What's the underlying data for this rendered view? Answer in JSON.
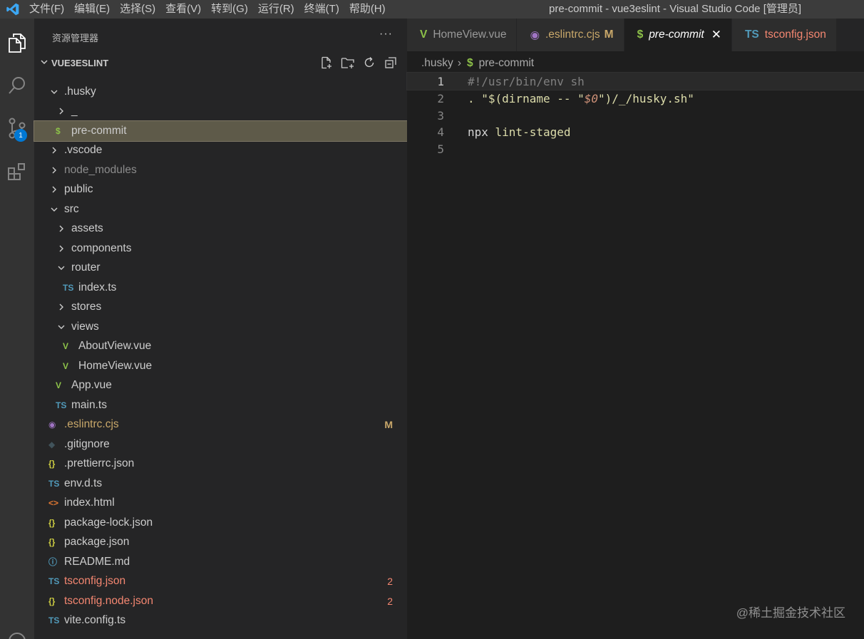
{
  "titlebar": {
    "menu": [
      "文件(F)",
      "编辑(E)",
      "选择(S)",
      "查看(V)",
      "转到(G)",
      "运行(R)",
      "终端(T)",
      "帮助(H)"
    ],
    "title": "pre-commit - vue3eslint - Visual Studio Code [管理员]"
  },
  "activitybar": {
    "icons": [
      "explorer-icon",
      "search-icon",
      "source-control-icon",
      "extensions-icon",
      "account-icon"
    ],
    "scm_badge": "1"
  },
  "sidebar": {
    "header": "资源管理器",
    "more": "···",
    "section": "VUE3ESLINT",
    "tree": [
      {
        "label": ".husky",
        "depth": 0,
        "kind": "folder-open"
      },
      {
        "label": "_",
        "depth": 1,
        "kind": "folder"
      },
      {
        "label": "pre-commit",
        "depth": 1,
        "kind": "file",
        "icon": "$",
        "iconColor": "#8dc149",
        "selected": true
      },
      {
        "label": ".vscode",
        "depth": 0,
        "kind": "folder"
      },
      {
        "label": "node_modules",
        "depth": 0,
        "kind": "folder",
        "dim": true
      },
      {
        "label": "public",
        "depth": 0,
        "kind": "folder"
      },
      {
        "label": "src",
        "depth": 0,
        "kind": "folder-open"
      },
      {
        "label": "assets",
        "depth": 1,
        "kind": "folder"
      },
      {
        "label": "components",
        "depth": 1,
        "kind": "folder"
      },
      {
        "label": "router",
        "depth": 1,
        "kind": "folder-open"
      },
      {
        "label": "index.ts",
        "depth": 2,
        "kind": "file",
        "icon": "TS",
        "iconColor": "#519aba"
      },
      {
        "label": "stores",
        "depth": 1,
        "kind": "folder"
      },
      {
        "label": "views",
        "depth": 1,
        "kind": "folder-open"
      },
      {
        "label": "AboutView.vue",
        "depth": 2,
        "kind": "file",
        "icon": "V",
        "iconColor": "#8dc149"
      },
      {
        "label": "HomeView.vue",
        "depth": 2,
        "kind": "file",
        "icon": "V",
        "iconColor": "#8dc149"
      },
      {
        "label": "App.vue",
        "depth": 1,
        "kind": "file",
        "icon": "V",
        "iconColor": "#8dc149"
      },
      {
        "label": "main.ts",
        "depth": 1,
        "kind": "file",
        "icon": "TS",
        "iconColor": "#519aba"
      },
      {
        "label": ".eslintrc.cjs",
        "depth": 0,
        "kind": "file",
        "icon": "◉",
        "iconColor": "#a074c4",
        "labelColor": "#c9a86a",
        "deco": "M",
        "decoType": "m"
      },
      {
        "label": ".gitignore",
        "depth": 0,
        "kind": "file",
        "icon": "◆",
        "iconColor": "#41535b"
      },
      {
        "label": ".prettierrc.json",
        "depth": 0,
        "kind": "file",
        "icon": "{}",
        "iconColor": "#cbcb41"
      },
      {
        "label": "env.d.ts",
        "depth": 0,
        "kind": "file",
        "icon": "TS",
        "iconColor": "#519aba"
      },
      {
        "label": "index.html",
        "depth": 0,
        "kind": "file",
        "icon": "<>",
        "iconColor": "#e37933"
      },
      {
        "label": "package-lock.json",
        "depth": 0,
        "kind": "file",
        "icon": "{}",
        "iconColor": "#cbcb41"
      },
      {
        "label": "package.json",
        "depth": 0,
        "kind": "file",
        "icon": "{}",
        "iconColor": "#cbcb41"
      },
      {
        "label": "README.md",
        "depth": 0,
        "kind": "file",
        "icon": "ⓘ",
        "iconColor": "#519aba"
      },
      {
        "label": "tsconfig.json",
        "depth": 0,
        "kind": "file",
        "icon": "TS",
        "iconColor": "#519aba",
        "labelColor": "#f48771",
        "deco": "2",
        "decoType": "e"
      },
      {
        "label": "tsconfig.node.json",
        "depth": 0,
        "kind": "file",
        "icon": "{}",
        "iconColor": "#cbcb41",
        "labelColor": "#f48771",
        "deco": "2",
        "decoType": "e"
      },
      {
        "label": "vite.config.ts",
        "depth": 0,
        "kind": "file",
        "icon": "TS",
        "iconColor": "#519aba"
      }
    ]
  },
  "tabs": [
    {
      "label": "HomeView.vue",
      "icon": "V",
      "iconColor": "#8dc149"
    },
    {
      "label": ".eslintrc.cjs",
      "icon": "◉",
      "iconColor": "#a074c4",
      "labelColor": "#c9a86a",
      "modified": "M"
    },
    {
      "label": "pre-commit",
      "icon": "$",
      "iconColor": "#8dc149",
      "active": true,
      "close": "✕"
    },
    {
      "label": "tsconfig.json",
      "icon": "TS",
      "iconColor": "#519aba",
      "labelColor": "#f48771"
    }
  ],
  "breadcrumb": {
    "folder": ".husky",
    "sep": "›",
    "icon": "$",
    "file": "pre-commit"
  },
  "editor": {
    "line_numbers": [
      "1",
      "2",
      "3",
      "4",
      "5"
    ],
    "lines": {
      "l1": "#!/usr/bin/env sh",
      "l2_a": ". ",
      "l2_b": "\"$(dirname -- \"",
      "l2_c": "$0",
      "l2_d": "\")/_/husky.sh\"",
      "l4_a": "npx ",
      "l4_b": "lint-staged"
    }
  },
  "watermark": "@稀土掘金技术社区"
}
